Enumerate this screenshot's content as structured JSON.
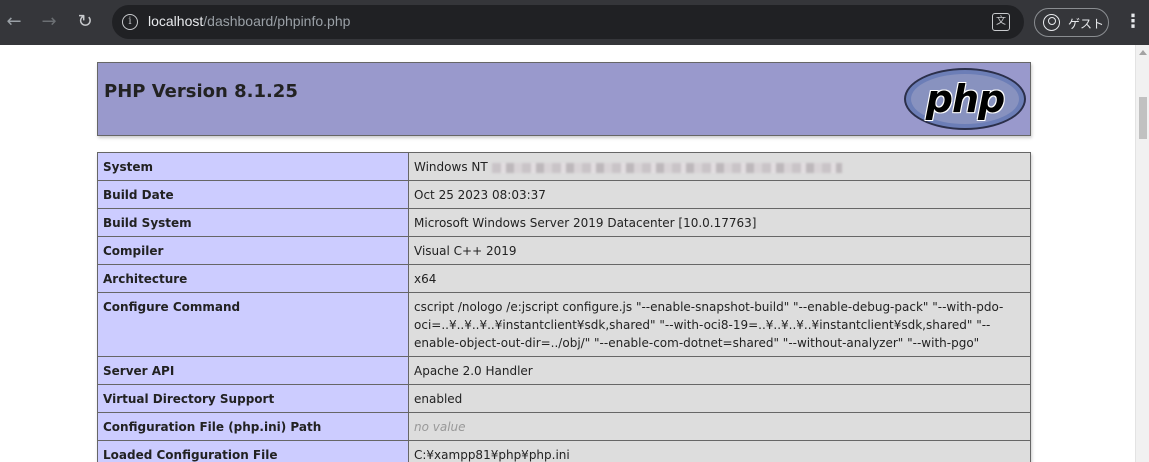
{
  "browser": {
    "url_host": "localhost",
    "url_path": "/dashboard/phpinfo.php",
    "profile_label": "ゲスト",
    "icons": {
      "back": "arrow-left-icon",
      "forward": "arrow-right-icon",
      "reload": "reload-icon",
      "site_info": "info-icon",
      "translate": "translate-icon",
      "profile": "profile-icon",
      "menu": "kebab-menu-icon"
    }
  },
  "page": {
    "title": "PHP Version 8.1.25",
    "logo_text": "php",
    "colors": {
      "header_bg": "#9999cc",
      "label_bg": "#ccccff",
      "value_bg": "#dddddd",
      "border": "#666666"
    },
    "rows": [
      {
        "label": "System",
        "value": "Windows NT",
        "redacted": true
      },
      {
        "label": "Build Date",
        "value": "Oct 25 2023 08:03:37"
      },
      {
        "label": "Build System",
        "value": "Microsoft Windows Server 2019 Datacenter [10.0.17763]"
      },
      {
        "label": "Compiler",
        "value": "Visual C++ 2019"
      },
      {
        "label": "Architecture",
        "value": "x64"
      },
      {
        "label": "Configure Command",
        "value": "cscript /nologo /e:jscript configure.js \"--enable-snapshot-build\" \"--enable-debug-pack\" \"--with-pdo-oci=..¥..¥..¥..¥instantclient¥sdk,shared\" \"--with-oci8-19=..¥..¥..¥..¥instantclient¥sdk,shared\" \"--enable-object-out-dir=../obj/\" \"--enable-com-dotnet=shared\" \"--without-analyzer\" \"--with-pgo\""
      },
      {
        "label": "Server API",
        "value": "Apache 2.0 Handler"
      },
      {
        "label": "Virtual Directory Support",
        "value": "enabled"
      },
      {
        "label": "Configuration File (php.ini) Path",
        "value": "no value",
        "novalue": true
      },
      {
        "label": "Loaded Configuration File",
        "value": "C:¥xampp81¥php¥php.ini"
      }
    ]
  }
}
